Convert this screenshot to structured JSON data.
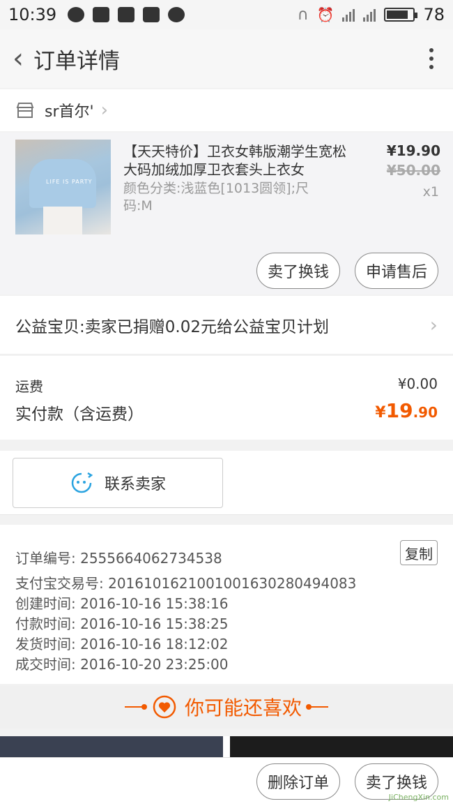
{
  "statusbar": {
    "time": "10:39",
    "battery": "78"
  },
  "navbar": {
    "title": "订单详情"
  },
  "shop": {
    "name": "sr首尔'"
  },
  "item": {
    "title": "【天天特价】卫衣女韩版潮学生宽松大码加绒加厚卫衣套头上衣女",
    "sku": "颜色分类:浅蓝色[1013圆领];尺码:M",
    "price": "¥19.90",
    "original_price": "¥50.00",
    "quantity": "x1",
    "image_text": "LIFE IS PARTY",
    "btn_sell": "卖了换钱",
    "btn_after_sale": "申请售后"
  },
  "charity": {
    "text": "公益宝贝:卖家已捐赠0.02元给公益宝贝计划"
  },
  "fees": {
    "shipping_label": "运费",
    "shipping_value": "¥0.00",
    "paid_label": "实付款（含运费）",
    "paid_currency": "¥",
    "paid_int": "19",
    "paid_dec": ".90"
  },
  "contact": {
    "label": "联系卖家"
  },
  "order": {
    "number": "订单编号: 2555664062734538",
    "alipay": "支付宝交易号: 2016101621001001630280494083",
    "created": "创建时间: 2016-10-16 15:38:16",
    "paid": "付款时间: 2016-10-16 15:38:25",
    "shipped": "发货时间: 2016-10-16 18:12:02",
    "closed": "成交时间: 2016-10-20 23:25:00",
    "copy_label": "复制"
  },
  "recommend": {
    "title": "你可能还喜欢"
  },
  "bottom": {
    "btn_delete": "删除订单",
    "btn_sell": "卖了换钱"
  },
  "watermark": "JiChengXin.com",
  "colors": {
    "accent": "#f25a00",
    "contact_icon": "#2aa3e0"
  }
}
